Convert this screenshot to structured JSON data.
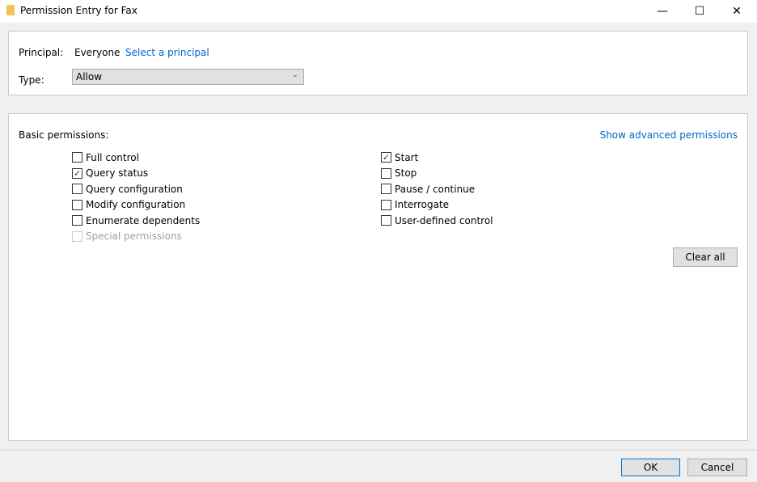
{
  "window": {
    "title": "Permission Entry for Fax",
    "minimize": "—",
    "maximize": "☐",
    "close": "✕"
  },
  "principal": {
    "label": "Principal:",
    "value": "Everyone",
    "link": "Select a principal"
  },
  "type": {
    "label": "Type:",
    "value": "Allow"
  },
  "permissions": {
    "label": "Basic permissions:",
    "advanced_link": "Show advanced permissions",
    "clear_all": "Clear all",
    "left": [
      {
        "label": "Full control",
        "checked": false
      },
      {
        "label": "Query status",
        "checked": true
      },
      {
        "label": "Query configuration",
        "checked": false
      },
      {
        "label": "Modify configuration",
        "checked": false
      },
      {
        "label": "Enumerate dependents",
        "checked": false
      },
      {
        "label": "Special permissions",
        "checked": false,
        "disabled": true
      }
    ],
    "right": [
      {
        "label": "Start",
        "checked": true
      },
      {
        "label": "Stop",
        "checked": false
      },
      {
        "label": "Pause / continue",
        "checked": false
      },
      {
        "label": "Interrogate",
        "checked": false
      },
      {
        "label": "User-defined control",
        "checked": false
      }
    ]
  },
  "footer": {
    "ok": "OK",
    "cancel": "Cancel"
  }
}
